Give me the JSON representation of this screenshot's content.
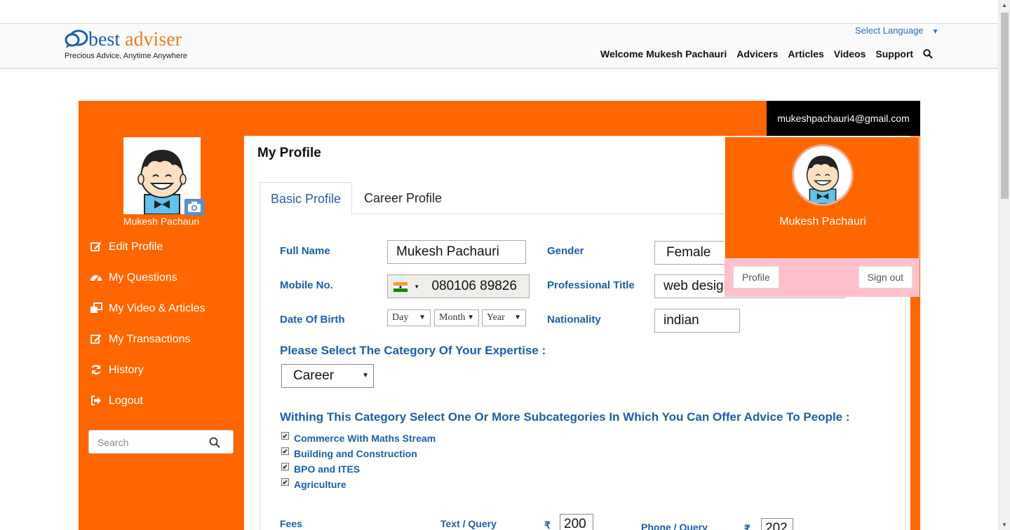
{
  "header": {
    "logo_best": "best",
    "logo_adviser": "adviser",
    "tagline": "Precious Advice, Anytime Anywhere",
    "language": "Select Language",
    "nav": [
      "Welcome Mukesh Pachauri",
      "Advicers",
      "Articles",
      "Videos",
      "Support"
    ]
  },
  "panel": {
    "email": "mukeshpachauri4@gmail.com"
  },
  "sidebar": {
    "name": "Mukesh Pachauri",
    "items": [
      {
        "label": "Edit Profile",
        "icon": "edit-icon"
      },
      {
        "label": "My Questions",
        "icon": "dashboard-icon"
      },
      {
        "label": "My Video & Articles",
        "icon": "clone-icon"
      },
      {
        "label": "My Transactions",
        "icon": "edit-icon"
      },
      {
        "label": "History",
        "icon": "refresh-icon"
      },
      {
        "label": "Logout",
        "icon": "sign-out-icon"
      }
    ],
    "search_placeholder": "Search"
  },
  "main": {
    "title": "My Profile",
    "tabs": [
      "Basic Profile",
      "Career Profile"
    ],
    "form": {
      "full_name_label": "Full Name",
      "full_name_value": "Mukesh Pachauri",
      "gender_label": "Gender",
      "gender_value": "Female",
      "mobile_label": "Mobile No.",
      "mobile_value": "080106 89826",
      "prof_title_label": "Professional Title",
      "prof_title_value": "web designer",
      "dob_label": "Date Of Birth",
      "dob_day": "Day",
      "dob_month": "Month",
      "dob_year": "Year",
      "nationality_label": "Nationality",
      "nationality_value": "indian",
      "category_heading": "Please Select The Category Of Your Expertise :",
      "category_value": "Career",
      "subcat_heading": "Withing This Category Select One Or More Subcategories In Which You Can Offer Advice To People :",
      "subcategories": [
        "Commerce With Maths Stream",
        "Building and Construction",
        "BPO and ITES",
        "Agriculture"
      ],
      "fees_label": "Fees",
      "text_query_label": "Text / Query",
      "text_query_value": "200",
      "phone_query_label": "Phone / Query",
      "phone_query_value": "202",
      "currency": "₹"
    }
  },
  "popup": {
    "name": "Mukesh Pachauri",
    "profile_button": "Profile",
    "signout_button": "Sign out"
  },
  "colors": {
    "brand_orange": "#ff6600",
    "brand_blue": "#1b5fa8",
    "popup_footer": "#ffc0cb"
  }
}
